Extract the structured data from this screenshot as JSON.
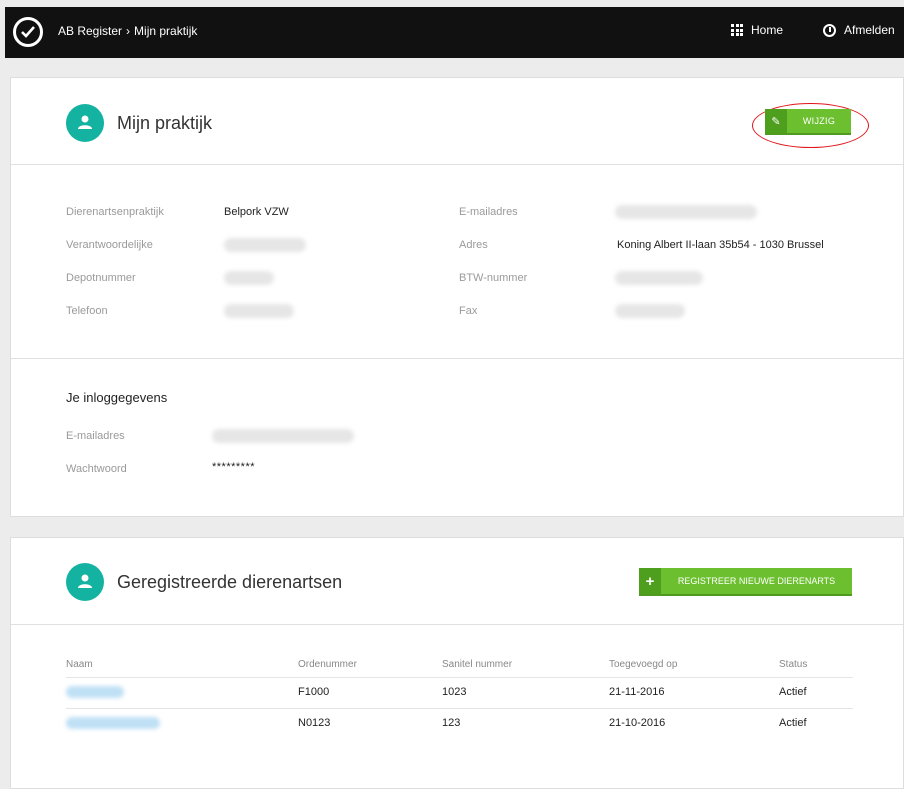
{
  "topbar": {
    "app_name": "AB Register",
    "separator": "›",
    "current_page": "Mijn praktijk",
    "home_label": "Home",
    "logout_label": "Afmelden"
  },
  "practice": {
    "title": "Mijn praktijk",
    "edit_button": "WIJZIG",
    "fields": {
      "practice_label": "Dierenartsenpraktijk",
      "practice_value": "Belpork VZW",
      "responsible_label": "Verantwoordelijke",
      "depot_label": "Depotnummer",
      "phone_label": "Telefoon",
      "email_label": "E-mailadres",
      "address_label": "Adres",
      "address_value": "Koning Albert II-laan 35b54 - 1030 Brussel",
      "vat_label": "BTW-nummer",
      "fax_label": "Fax"
    }
  },
  "login": {
    "heading": "Je inloggegevens",
    "email_label": "E-mailadres",
    "password_label": "Wachtwoord",
    "password_value": "*********"
  },
  "vets": {
    "title": "Geregistreerde dierenartsen",
    "register_button": "REGISTREER NIEUWE DIERENARTS",
    "columns": [
      "Naam",
      "Ordenummer",
      "Sanitel nummer",
      "Toegevoegd op",
      "Status"
    ],
    "rows": [
      {
        "order": "F1000",
        "sanitel": "1023",
        "added": "21-11-2016",
        "status": "Actief"
      },
      {
        "order": "N0123",
        "sanitel": "123",
        "added": "21-10-2016",
        "status": "Actief"
      }
    ]
  },
  "colors": {
    "accent_green": "#6cbf2f",
    "teal": "#14b3a1",
    "annotation_red": "#e0151a"
  }
}
